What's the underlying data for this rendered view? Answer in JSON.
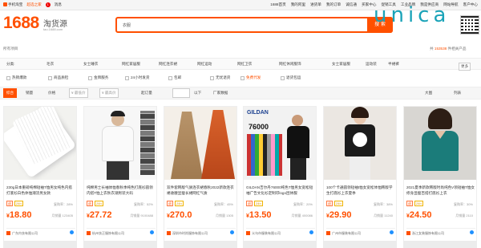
{
  "topbar": {
    "mobile": "手机淘宝",
    "home": "超选之家",
    "badge": "1",
    "msg": "消息",
    "right": [
      "1688首页",
      "我的阿里",
      "进货单",
      "我的订单",
      "诚信通",
      "买家中心",
      "促销工具",
      "工业品牌",
      "我是供应商",
      "网站导航",
      "客户中心"
    ]
  },
  "logo": {
    "main": "1688",
    "sub": "淘货源",
    "url": "tao.1688.com"
  },
  "watermark": {
    "text": "unica"
  },
  "search": {
    "value": "衣服",
    "button": "搜 索"
  },
  "crumb": "所有项目",
  "count": {
    "prefix": "共",
    "num": "153538",
    "suffix": "件相关产品"
  },
  "categories": [
    "分类:",
    "毛衣",
    "女士睡衣",
    "网红家居服",
    "网红连衣裙",
    "网红运动",
    "网红卫衣",
    "网红休闲服饰",
    "女士家居服",
    "运动装",
    "半裙裤"
  ],
  "more": "更多",
  "filters": [
    "热销爆款",
    "商品质检",
    "金牌服务",
    "24小时发货",
    "包邮",
    "无忧退货",
    "免费代发",
    "退货包运"
  ],
  "sort": {
    "all": "综合",
    "sales": "销量",
    "price": "价格",
    "price_from": "¥ 最低价",
    "price_to": "¥ 最高价",
    "qty": "起订量",
    "repeat": "回头率",
    "from": "以下",
    "seller": "厂家数据",
    "grid": "大图",
    "list": "列表"
  },
  "products": [
    {
      "title": "230g日本重磅纯棉短袖T恤男女纯色内搭打底衫白色体恤潮流男女款",
      "tags": [
        "退",
        "24h"
      ],
      "rep": "复购率：28%",
      "price": "18.80",
      "sold": "月销量 123405",
      "store": "广东内衣有限公司"
    },
    {
      "title": "纯棉男士长袖体恤春秋季纯色打底衫圆领内搭T恤上衣秋衣潮男装大码",
      "tags": [
        "退",
        "24h"
      ],
      "rep": "复购率：52%",
      "price": "27.72",
      "sold": "月销量 9100488",
      "store": "杭州衣正服饰有限公司"
    },
    {
      "title": "双件套韩版气质连衣裙春秋2022新款连衣裙收腰显瘦长裙网红气质",
      "tags": [
        "退",
        "24h"
      ],
      "rep": "复购率：45%",
      "price": "270.0",
      "sold": "月销量 1305",
      "store": "深圳市时尚服饰有限公司"
    },
    {
      "title": "GILDAN吉尔丹76000纯色T恤男女宽松短袖广告文化衫定制印logo团体服",
      "tags": [
        "退",
        "24h"
      ],
      "rep": "复购率：20%",
      "price": "13.50",
      "sold": "月销量 400086",
      "store": "义乌市服装有限公司"
    },
    {
      "title": "100个卡通圆领短袖t恤女宽松体恤韩版学生打底衫上衣夏季",
      "tags": [
        "退",
        "24h"
      ],
      "rep": "复购率：38%",
      "price": "29.90",
      "sold": "月销量 11240",
      "store": "广州市服装有限公司"
    },
    {
      "title": "2021夏季新款韩版时尚纯色V领短袖T恤女修身显瘦百搭打底衫上衣",
      "tags": [
        "退",
        "24h"
      ],
      "rep": "复购率：30%",
      "price": "24.50",
      "sold": "月销量 2110",
      "store": "浙江女装服饰有限公司"
    }
  ],
  "gildan": {
    "brand": "GILDAN",
    "model": "76000"
  },
  "colors": {
    "accent": "#ff5000",
    "watermark": "#1aa3b8"
  }
}
